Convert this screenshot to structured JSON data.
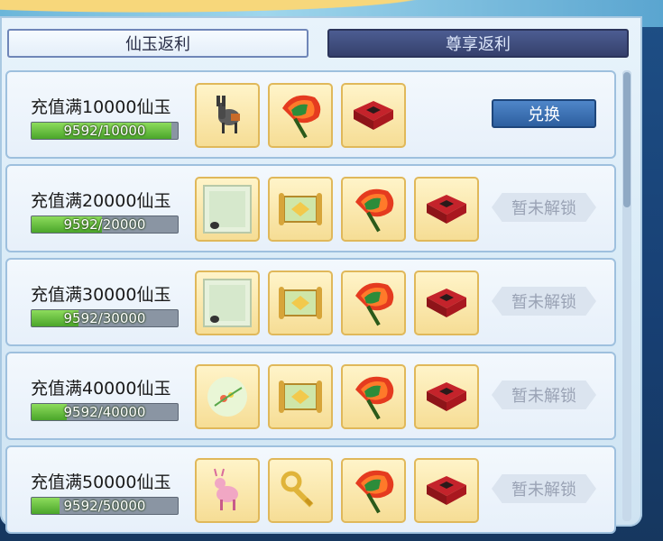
{
  "tabs": [
    {
      "label": "仙玉返利",
      "active": true
    },
    {
      "label": "尊享返利",
      "active": false
    }
  ],
  "rows": [
    {
      "label": "充值满10000仙玉",
      "progress_text": "9592/10000",
      "progress": 0.9592,
      "button": "兑换",
      "button_state": "active",
      "rewards": [
        "donkey-mount-icon",
        "flame-fan-icon",
        "red-carpet-icon"
      ]
    },
    {
      "label": "充值满20000仙玉",
      "progress_text": "9592/20000",
      "progress": 0.4796,
      "button": "暂未解锁",
      "button_state": "locked",
      "rewards": [
        "picture-frame-icon",
        "scroll-icon",
        "flame-fan-icon",
        "red-carpet-icon"
      ]
    },
    {
      "label": "充值满30000仙玉",
      "progress_text": "9592/30000",
      "progress": 0.3197,
      "button": "暂未解锁",
      "button_state": "locked",
      "rewards": [
        "picture-frame-icon",
        "scroll-icon",
        "flame-fan-icon",
        "red-carpet-icon"
      ]
    },
    {
      "label": "充值满40000仙玉",
      "progress_text": "9592/40000",
      "progress": 0.2398,
      "button": "暂未解锁",
      "button_state": "locked",
      "rewards": [
        "flower-sprig-icon",
        "scroll-icon",
        "flame-fan-icon",
        "red-carpet-icon"
      ]
    },
    {
      "label": "充值满50000仙玉",
      "progress_text": "9592/50000",
      "progress": 0.1918,
      "button": "暂未解锁",
      "button_state": "locked",
      "rewards": [
        "pink-deer-mount-icon",
        "golden-key-icon",
        "flame-fan-icon",
        "red-carpet-icon"
      ]
    }
  ]
}
